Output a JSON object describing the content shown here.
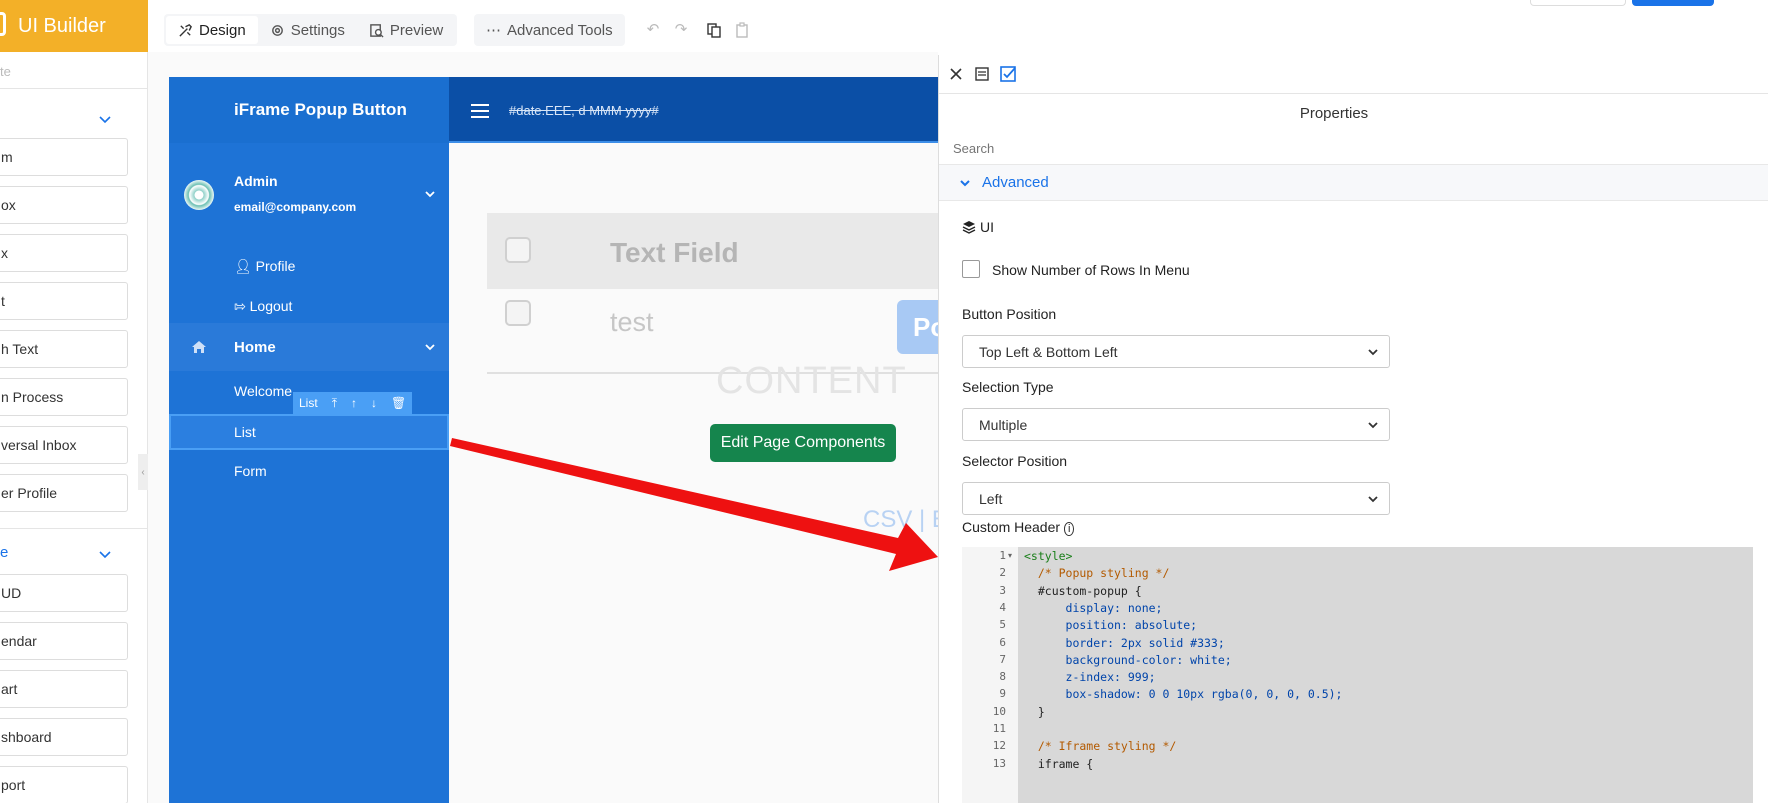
{
  "brand": {
    "name": "UI Builder"
  },
  "toolbar": {
    "tabs": [
      {
        "label": "Design",
        "icon": "tools-icon",
        "active": true
      },
      {
        "label": "Settings",
        "icon": "gear-icon"
      },
      {
        "label": "Preview",
        "icon": "preview-icon"
      }
    ],
    "advanced_tools": "Advanced Tools"
  },
  "components": {
    "search_placeholder": "te",
    "section2_label": "e",
    "items": [
      "m",
      "ox",
      "x",
      "t",
      "h Text",
      "n Process",
      "versal Inbox",
      "er Profile",
      "UD",
      "endar",
      "art",
      "shboard",
      "port"
    ]
  },
  "app": {
    "title": "iFrame Popup Button",
    "admin_name": "Admin",
    "admin_email": "email@company.com",
    "menu": {
      "profile": "Profile",
      "logout": "Logout",
      "home": "Home",
      "welcome": "Welcome",
      "list": "List",
      "form": "Form"
    },
    "sub_toolbar_label": "List",
    "date_format": "#date.EEE, d MMM yyyy#",
    "table": {
      "header": "Text Field",
      "row": "test",
      "popup_btn": "Po"
    },
    "content_watermark": "CONTENT",
    "edit_button": "Edit Page Components",
    "export_links": "CSV | E"
  },
  "properties": {
    "title": "Properties",
    "search_placeholder": "Search",
    "section": "Advanced",
    "ui_heading": "UI",
    "show_rows_label": "Show Number of Rows In Menu",
    "show_rows_checked": false,
    "button_position": {
      "label": "Button Position",
      "value": "Top Left & Bottom Left"
    },
    "selection_type": {
      "label": "Selection Type",
      "value": "Multiple"
    },
    "selector_position": {
      "label": "Selector Position",
      "value": "Left"
    },
    "custom_header": {
      "label": "Custom Header"
    },
    "code_lines": [
      "<style>",
      "  /* Popup styling */",
      "  #custom-popup {",
      "      display: none;",
      "      position: absolute;",
      "      border: 2px solid #333;",
      "      background-color: white;",
      "      z-index: 999;",
      "      box-shadow: 0 0 10px rgba(0, 0, 0, 0.5);",
      "  }",
      "",
      "  /* Iframe styling */",
      "  iframe {"
    ]
  },
  "colors": {
    "brand": "#f3b028",
    "sidebar_blue": "#1e73d6",
    "header_blue": "#0b4fa6",
    "accent": "#1a73e8",
    "edit_button": "#15854d",
    "arrow": "#ee1111"
  }
}
